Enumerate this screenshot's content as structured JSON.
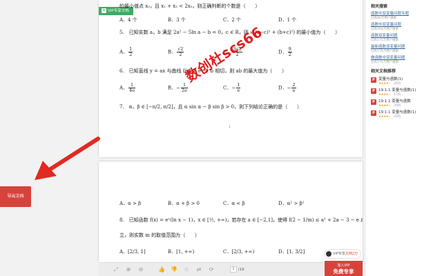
{
  "page1": {
    "vip_tag": "VIP专享文档",
    "lines": [
      "的最小值点 x₀，且 x₁ + x₂ < 2x₀，则正确判断的个数是（　　）",
      "5.　已知实数 a，b 满足 2a² − 5ln a − b = 0，c ∈ R，则 √((a−c)² + (b+c)²) 的最小值为（　　）",
      "6.　已知直线 y = ax 与曲线 f(x) = eˣ + b 相切，则 ab 的最大值为（　　）",
      "7.　α，β ∈ [−π/2, π/2]，且 α sin α − β sin β > 0，则下列结论正确的是（　　）"
    ],
    "q4_options": [
      "A．4 个",
      "B．3 个",
      "C．2 个",
      "D．1 个"
    ],
    "q5_options": [
      {
        "letter": "A．",
        "num": "1",
        "den": "2"
      },
      {
        "letter": "B．",
        "num": "√2",
        "den": "2"
      },
      {
        "letter": "C．",
        "num": "3√2",
        "den": "2"
      },
      {
        "letter": "D．",
        "num": "9",
        "den": "2"
      }
    ],
    "q6_options": [
      {
        "letter": "A．",
        "num": "1",
        "den": "4e"
      },
      {
        "letter": "B．−",
        "num": "1",
        "den": "2e"
      },
      {
        "letter": "C．−",
        "num": "1",
        "den": "e"
      },
      {
        "letter": "D．−",
        "num": "2",
        "den": "e"
      }
    ],
    "page_number": "1"
  },
  "page2": {
    "q7_options": [
      "A．α > β",
      "B．α + β > 0",
      "C．α < β",
      "D．α² > β²"
    ],
    "q8_line1": "8.　已知函数 f(x) = eˣ(ln x − 1)，x ∈ [½, +∞)，若存在 a ∈ [−2,1]，使得 f(2 − 1/m) ≤ a² + 2a − 3 − e 成",
    "q8_line2": "立，则实数 m 的取值范围为（　　）",
    "q8_options": [
      "A．[2/3, 1]",
      "B．[1, +∞)",
      "C．[2/3, +∞)",
      "D．[1, 3/2]"
    ]
  },
  "watermark": "数创杜scs66",
  "toolbar": {
    "icons": [
      "expand-icon",
      "zoom-in-icon",
      "zoom-out-icon",
      "thumbs-up-icon",
      "thumbs-down-icon",
      "collect-icon",
      "share-icon",
      "next-icon"
    ],
    "icon_glyphs": [
      "⤢",
      "⊕",
      "⊖",
      "👍",
      "👎",
      "☆",
      "⇄",
      "⟳"
    ],
    "page_current": "1",
    "page_total": "/18",
    "vip_chip_text": "VIP专享",
    "vip_chip_highlight": "文档2万",
    "join_small": "加入VIP",
    "join_big": "免费专享"
  },
  "export_button": "导出文档",
  "sidebar": {
    "related_title": "相关搜索",
    "related": [
      {
        "label": "函数中双变量问题专题",
        "meta": "已有80万用户搜索"
      },
      {
        "label": "函数中双变量问题",
        "meta": "已有264万用户搜索"
      },
      {
        "label": "函数双变量问题",
        "meta": "已有175万用户搜索"
      },
      {
        "label": "最新函数双变量问题",
        "meta": "已有176万用户搜索"
      },
      {
        "label": "做函数中双变量问题",
        "meta": "已有275万用户搜索"
      }
    ],
    "recommend_title": "相关文档推荐",
    "docs": [
      {
        "name": "变量与函数(1)",
        "stars": "★★★★☆",
        "pages": "26页"
      },
      {
        "name": "19.1.1 变量与函数(1)",
        "stars": "★★★★☆",
        "pages": "17页"
      },
      {
        "name": "19.1.1 变量与函数",
        "stars": "★★★★☆",
        "pages": "20页"
      },
      {
        "name": "19.1.1 变量与函数(1)",
        "stars": "★★★★☆",
        "pages": "20页"
      }
    ]
  },
  "colors": {
    "accent_red": "#d7433b",
    "vip_green": "#3dab62",
    "link_blue": "#3a6a9a"
  }
}
